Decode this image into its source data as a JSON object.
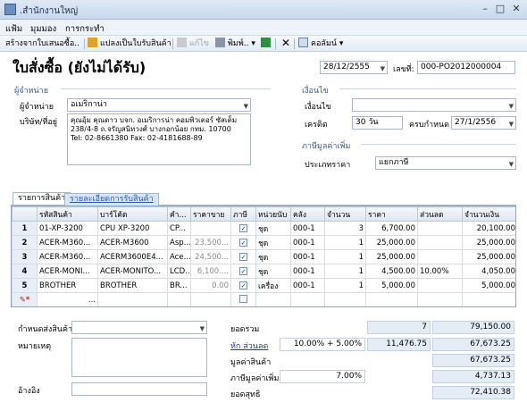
{
  "window": {
    "title": ".สำนักงานใหญ่"
  },
  "menu": [
    "แฟ้ม",
    "มุมมอง",
    "การกระทำ"
  ],
  "toolbar": {
    "create_from_quote": "สร้างจากใบเสนอซื้อ..",
    "convert": "แปลงเป็นใบรับสินค้า",
    "edit": "แก้ไข",
    "print": "พิมพ์..",
    "column": "คอลัมน์"
  },
  "doc": {
    "title": "ใบสั่งซื้อ (ยังไม่ได้รับ)",
    "date": "28/12/2555",
    "number_label": "เลขที่:",
    "number": "000-PO2012000004"
  },
  "supplier": {
    "group_title": "ผู้จำหน่าย",
    "vendor_label": "ผู้จำหน่าย",
    "vendor": "อเมริกาน่า",
    "company_label": "บริษัท/ที่อยู่",
    "address": [
      "คุณอุ้ม คุณดาว บจก. อเมริการน่า คอมพิวเตอร์ ซัสเต็ม",
      "238/4-8 ถ.จรัญสนิทวงศ์ บางกอกน้อย กทม. 10700",
      "Tel: 02-8661380  Fax: 02-4181688-89"
    ]
  },
  "terms": {
    "group_title": "เงื่อนไข",
    "cond_label": "เงื่อนไข",
    "cond_value": "",
    "credit_label": "เครดิต",
    "credit_value": "30 วัน",
    "due_label": "ครบกำหนด",
    "due_value": "27/1/2556"
  },
  "vat": {
    "group_title": "ภาษีมูลค่าเพิ่ม",
    "type_label": "ประเภทราคา",
    "type_value": "แยกภาษี"
  },
  "tabs": [
    "รายการสินค้า",
    "รายละเอียดการรับสินค้า"
  ],
  "grid": {
    "headers": [
      "รหัสสินค้า",
      "บาร์โค้ด",
      "คำ...",
      "ราคาขาย",
      "ภาษี",
      "หน่วยนับ",
      "คลัง",
      "จำนวน",
      "ราคา",
      "ส่วนลด",
      "จำนวนเงิน"
    ],
    "rows": [
      {
        "n": "1",
        "code": "01-XP-3200",
        "barcode": "CPU XP-3200",
        "desc": "CP...",
        "sale": "",
        "vat": "✓",
        "unit": "ชุด",
        "wh": "000-1",
        "qty": "3",
        "price": "6,700.00",
        "disc": "",
        "amount": "20,100.00"
      },
      {
        "n": "2",
        "code": "ACER-M360...",
        "barcode": "ACER-M3600",
        "desc": "Asp...",
        "sale": "23,500...",
        "vat": "✓",
        "unit": "ชุด",
        "wh": "000-1",
        "qty": "1",
        "price": "25,000.00",
        "disc": "",
        "amount": "25,000.00"
      },
      {
        "n": "3",
        "code": "ACER-M360...",
        "barcode": "ACERM3600E4...",
        "desc": "Ace...",
        "sale": "24,500...",
        "vat": "✓",
        "unit": "ชุด",
        "wh": "000-1",
        "qty": "1",
        "price": "25,000.00",
        "disc": "",
        "amount": "25,000.00"
      },
      {
        "n": "4",
        "code": "ACER-MONI...",
        "barcode": "ACER-MONITO...",
        "desc": "LCD...",
        "sale": "6,100....",
        "vat": "✓",
        "unit": "ชุด",
        "wh": "000-1",
        "qty": "1",
        "price": "4,500.00",
        "disc": "10.00%",
        "amount": "4,050.00"
      },
      {
        "n": "5",
        "code": "BROTHER",
        "barcode": "BROTHER",
        "desc": "BR...",
        "sale": "0.00",
        "vat": "✓",
        "unit": "เครื่อง",
        "wh": "000-1",
        "qty": "1",
        "price": "5,000.00",
        "disc": "",
        "amount": "5,000.00"
      }
    ],
    "new_row_button": "..."
  },
  "footer": {
    "delivery_label": "กำหนดส่งสินค้า",
    "note_label": "หมายเหตุ",
    "ref_label": "อ้างอิง",
    "total_label": "ยอดรวม",
    "total_qty": "7",
    "total_amount": "79,150.00",
    "discount_label": "หัก ส่วนลด",
    "discount_rate": "10.00% + 5.00%",
    "discount_amount": "11,476.75",
    "after_discount": "67,673.25",
    "goods_value_label": "มูลค่าสินค้า",
    "goods_value": "67,673.25",
    "vat_label": "ภาษีมูลค่าเพิ่ม",
    "vat_rate": "7.00%",
    "vat_amount": "4,737.13",
    "net_label": "ยอดสุทธิ",
    "net_amount": "72,410.38"
  },
  "colors": {
    "accent": "#2a56a6",
    "header_bg": "#dde6f2",
    "summary_bg": "#e4ecf6"
  }
}
